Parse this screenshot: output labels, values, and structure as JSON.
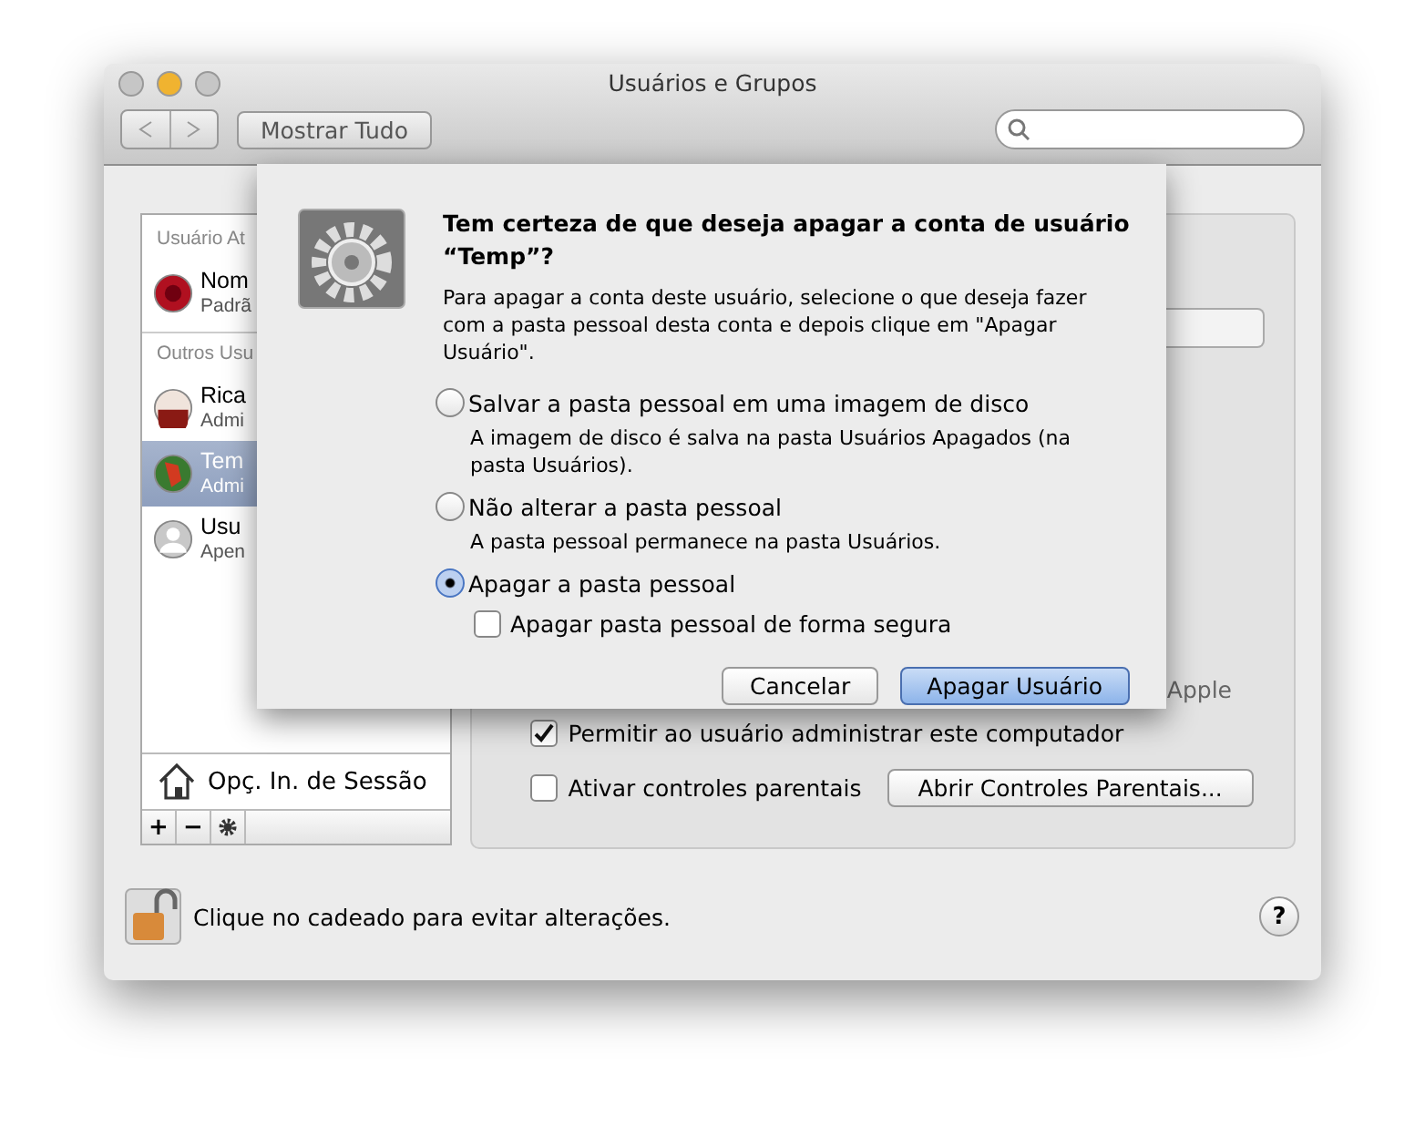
{
  "window": {
    "title": "Usuários e Grupos"
  },
  "toolbar": {
    "show_all": "Mostrar Tudo"
  },
  "sidebar": {
    "sections": [
      {
        "header": "Usuário At",
        "users": [
          {
            "name": "Nom",
            "role": "Padrã",
            "kind": "rose",
            "selected": false
          }
        ]
      },
      {
        "header": "Outros Usu",
        "users": [
          {
            "name": "Rica",
            "role": "Admi",
            "kind": "figure",
            "selected": false
          },
          {
            "name": "Tem",
            "role": "Admi",
            "kind": "parrot",
            "selected": true
          },
          {
            "name": "Usu",
            "role": "Apen",
            "kind": "guest",
            "selected": false
          }
        ]
      }
    ],
    "login_options": "Opç. In. de Sessão",
    "actions": [
      "+",
      "−"
    ]
  },
  "panel": {
    "apple_id_fragment": "Apple",
    "options": [
      {
        "label": "Permitir ao usuário administrar este computador",
        "checked": true
      },
      {
        "label": "Ativar controles parentais",
        "checked": false,
        "button": "Abrir Controles Parentais..."
      }
    ]
  },
  "footer": {
    "lock_text": "Clique no cadeado para evitar alterações.",
    "help": "?"
  },
  "sheet": {
    "title": "Tem certeza de que deseja apagar a conta de usuário “Temp”?",
    "message": "Para apagar a conta deste usuário, selecione o que deseja fazer com a pasta pessoal desta conta e depois clique em \"Apagar Usuário\".",
    "choices": [
      {
        "label": "Salvar a pasta pessoal em uma imagem de disco",
        "description": "A imagem de disco é salva na pasta Usuários Apagados (na pasta Usuários).",
        "selected": false
      },
      {
        "label": "Não alterar a pasta pessoal",
        "description": "A pasta pessoal permanece na pasta Usuários.",
        "selected": false
      },
      {
        "label": "Apagar a pasta pessoal",
        "selected": true
      }
    ],
    "secure_erase": {
      "label": "Apagar pasta pessoal de forma segura",
      "checked": false
    },
    "buttons": [
      {
        "label": "Cancelar",
        "default": false
      },
      {
        "label": "Apagar Usuário",
        "default": true
      }
    ]
  }
}
